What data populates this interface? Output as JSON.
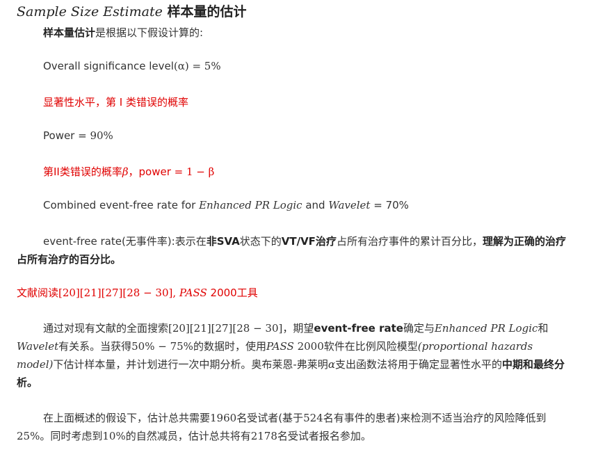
{
  "title": {
    "math": "Sample Size Estimate",
    "text": "样本量的估计"
  },
  "intro": {
    "bold": "样本量估计",
    "rest": "是根据以下假设计算的:"
  },
  "alpha_line": {
    "label": "Overall significance level",
    "math": "(α) = 5%"
  },
  "alpha_note": "显著性水平，第 I 类错误的概率",
  "power_line": {
    "label": "Power = ",
    "value": "90%"
  },
  "beta_note": {
    "prefix": "第II类错误的概率",
    "beta": "β",
    "mid": "，power = ",
    "expr": "1 − β"
  },
  "combined": {
    "prefix": "Combined event-free rate for ",
    "m1": "Enhanced PR Logic",
    "mid": " and ",
    "m2": "Wavelet",
    "suffix": " = 70%"
  },
  "efr": {
    "t1": "event-free rate(无事件率):表示在",
    "b1": "非SVA",
    "t2": "状态下的",
    "b2": "VT/VF治疗",
    "t3": "占所有治疗事件的累计百分比，",
    "b3": "理解为正确的治疗占所有治疗的百分比。"
  },
  "refs": {
    "t1": "文献阅读",
    "refs": "[20][21][27][28 − 30], ",
    "pass": "PASS",
    "t2": " 2000工具"
  },
  "search": {
    "t1": "通过对现有文献的全面搜索",
    "refs": "[20][21][27][28 − 30]",
    "t2": "，期望",
    "b1": "event-free rate",
    "t3": "确定与",
    "m1": "Enhanced PR Logic",
    "t4": "和",
    "m2": "Wavelet",
    "t5": "有关系。当获得",
    "range": "50% − 75%",
    "t6": "的数据时，使用",
    "pass": "PASS",
    "ver": " 2000",
    "t7": "软件在比例风险模型",
    "model": "(proportional hazards model)",
    "t8": "下估计样本量，并计划进行一次中期分析。奥布莱恩-弗莱明",
    "alpha": "α",
    "t9": "支出函数法将用于确定显著性水平的",
    "b2": "中期和最终分析。"
  },
  "summary": {
    "t1": "在上面概述的假设下，估计总共需要",
    "n1": "1960",
    "t2": "名受试者(基于",
    "n2": "524",
    "t3": "名有事件的患者)来检测不适当治疗的风险降低到",
    "n3": "25%",
    "t4": "。同时考虑到",
    "n4": "10%",
    "t5": "的自然减员，估计总共将有",
    "n5": "2178",
    "t6": "名受试者报名参加。"
  }
}
